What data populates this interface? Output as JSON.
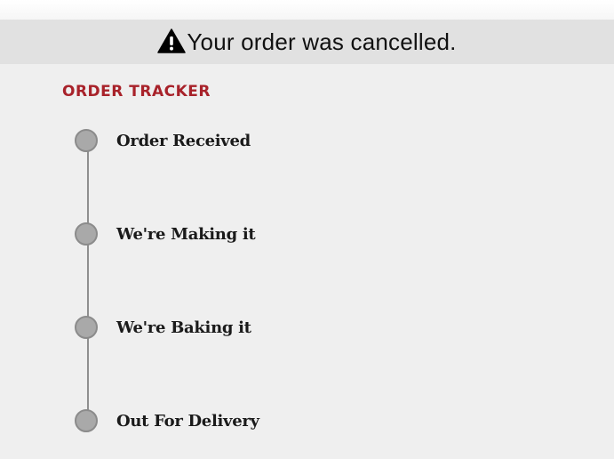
{
  "banner": {
    "icon": "warning-icon",
    "message": "Your order was cancelled."
  },
  "tracker": {
    "heading": "ORDER TRACKER",
    "steps": [
      {
        "label": "Order Received"
      },
      {
        "label": "We're Making it"
      },
      {
        "label": "We're Baking it"
      },
      {
        "label": "Out For Delivery"
      }
    ]
  }
}
